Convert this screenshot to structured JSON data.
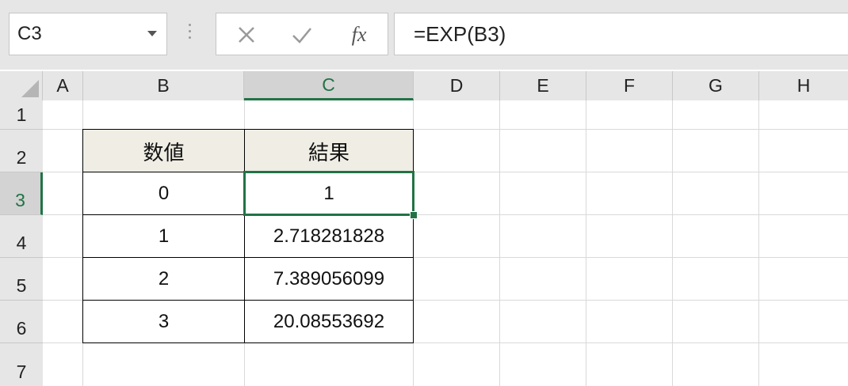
{
  "name_box": {
    "value": "C3"
  },
  "formula_bar": {
    "cancel_icon": "close-icon",
    "enter_icon": "check-icon",
    "fx_label": "fx",
    "formula": "=EXP(B3)"
  },
  "columns": [
    "A",
    "B",
    "C",
    "D",
    "E",
    "F",
    "G",
    "H"
  ],
  "selected_column": "C",
  "rows": [
    "1",
    "2",
    "3",
    "4",
    "5",
    "6",
    "7"
  ],
  "selected_row": "3",
  "table": {
    "headers": [
      "数値",
      "結果"
    ],
    "rows": [
      [
        "0",
        "1"
      ],
      [
        "1",
        "2.718281828"
      ],
      [
        "2",
        "7.389056099"
      ],
      [
        "3",
        "20.08553692"
      ]
    ]
  },
  "colors": {
    "accent": "#217346",
    "header_fill": "#efede4",
    "chrome": "#e6e6e6"
  }
}
